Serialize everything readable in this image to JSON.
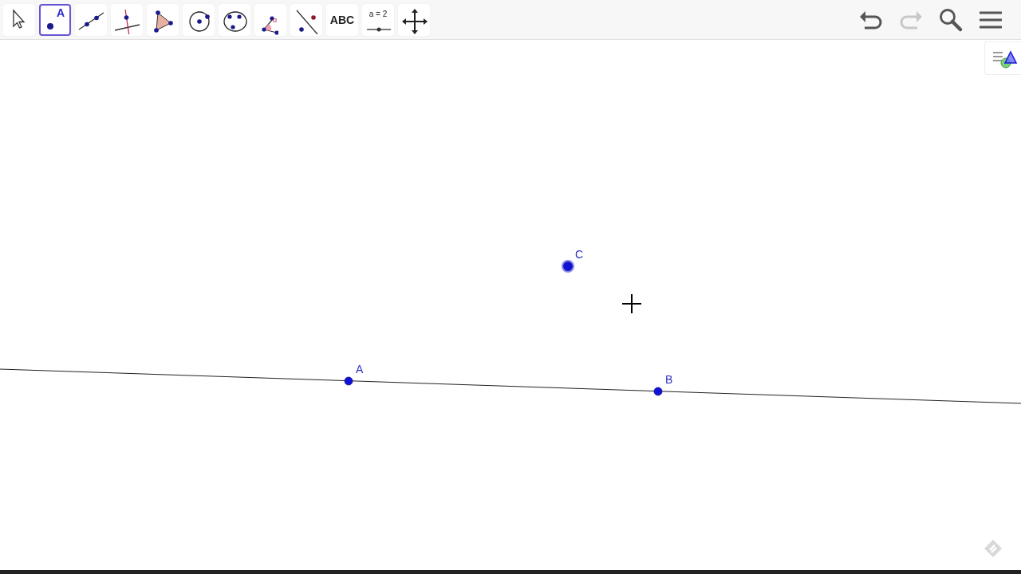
{
  "toolbar": {
    "tools": [
      {
        "kind": "move",
        "selected": false
      },
      {
        "kind": "point",
        "label": "A",
        "selected": true
      },
      {
        "kind": "line",
        "selected": false
      },
      {
        "kind": "perpendicular",
        "selected": false
      },
      {
        "kind": "polygon",
        "selected": false
      },
      {
        "kind": "circle",
        "selected": false
      },
      {
        "kind": "conic",
        "selected": false
      },
      {
        "kind": "angle",
        "label": "α",
        "selected": false
      },
      {
        "kind": "reflect",
        "selected": false
      },
      {
        "kind": "text",
        "label": "ABC",
        "selected": false
      },
      {
        "kind": "slider",
        "label": "a = 2",
        "selected": false
      },
      {
        "kind": "pan",
        "selected": false
      }
    ],
    "actions": [
      {
        "kind": "undo",
        "disabled": false
      },
      {
        "kind": "redo",
        "disabled": true
      },
      {
        "kind": "search",
        "disabled": false
      },
      {
        "kind": "menu",
        "disabled": false
      }
    ]
  },
  "canvas": {
    "points": [
      {
        "label": "A",
        "selected": false
      },
      {
        "label": "B",
        "selected": false
      },
      {
        "label": "C",
        "selected": true
      }
    ]
  }
}
